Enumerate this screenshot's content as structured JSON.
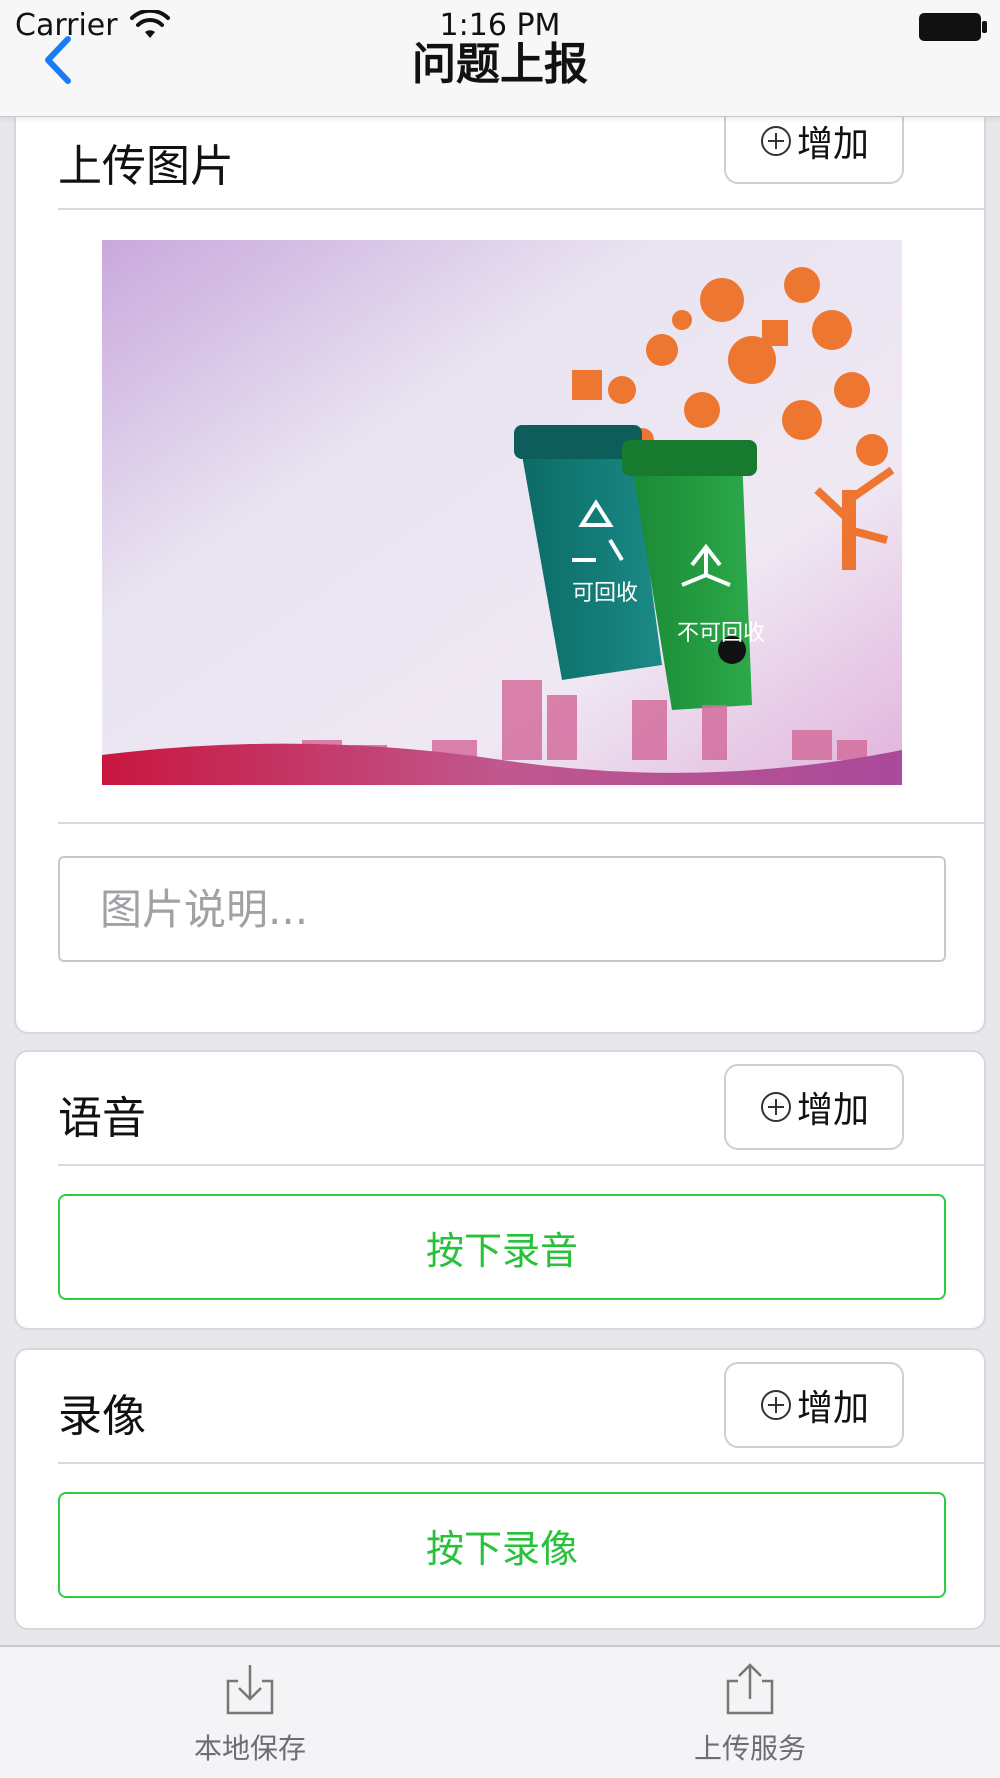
{
  "status_bar": {
    "carrier": "Carrier",
    "time": "1:16 PM"
  },
  "nav": {
    "title": "问题上报",
    "back_icon": "chevron-left-icon",
    "accent_color": "#1a7cf5"
  },
  "photo_section": {
    "title": "上传图片",
    "add_label": "增加",
    "caption_placeholder": "图片说明...",
    "caption_value": "",
    "image": {
      "bin_left_label": "可回收",
      "bin_right_label": "不可回收"
    }
  },
  "voice_section": {
    "title": "语音",
    "add_label": "增加",
    "record_button_label": "按下录音"
  },
  "video_section": {
    "title": "录像",
    "add_label": "增加",
    "record_button_label": "按下录像"
  },
  "toolbar": {
    "save_label": "本地保存",
    "upload_label": "上传服务",
    "save_icon": "download-tray-icon",
    "upload_icon": "share-upload-icon"
  },
  "colors": {
    "green_accent": "#27c23a",
    "toolbar_text": "#6d6d72"
  }
}
